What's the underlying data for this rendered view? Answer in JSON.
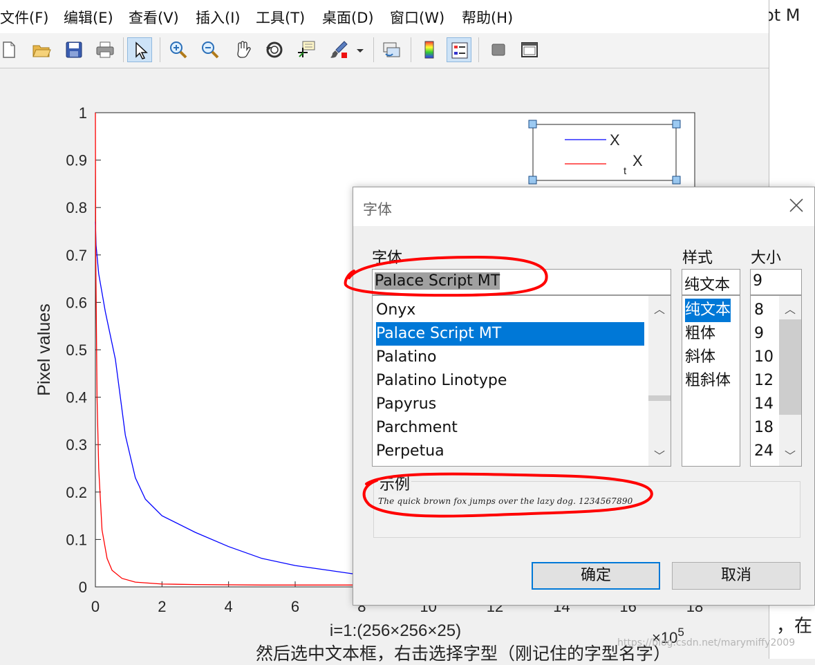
{
  "menubar": {
    "items": [
      "文件(F)",
      "编辑(E)",
      "查看(V)",
      "插入(I)",
      "工具(T)",
      "桌面(D)",
      "窗口(W)",
      "帮助(H)"
    ]
  },
  "toolbar": {
    "buttons": [
      "new-figure-icon",
      "open-file-icon",
      "save-icon",
      "print-icon",
      "pointer-icon",
      "zoom-in-icon",
      "zoom-out-icon",
      "pan-hand-icon",
      "rotate-3d-icon",
      "data-cursor-icon",
      "brush-icon",
      "link-plot-icon",
      "colorbar-icon",
      "legend-icon",
      "hide-tools-icon",
      "show-tools-icon"
    ],
    "pressed": [
      "pointer-icon",
      "legend-icon"
    ]
  },
  "background_document": {
    "title_fragment": "ript M",
    "text_line_1": "，在",
    "text_line_2": "然后选中文本框，右击选择字型（刚记住的字型名字）",
    "watermark": "https://blog.csdn.net/marymiffy2009"
  },
  "chart_data": {
    "type": "line",
    "xlabel": "i=1:(256×256×25)",
    "ylabel": "Pixel values",
    "x_exponent_label": "×10",
    "x_exponent_power": "5",
    "xlim": [
      0,
      18
    ],
    "ylim": [
      0,
      1
    ],
    "x_ticks": [
      "0",
      "2",
      "4",
      "6",
      "8",
      "10",
      "12",
      "14",
      "16",
      "18"
    ],
    "y_ticks": [
      "0",
      "0.1",
      "0.2",
      "0.3",
      "0.4",
      "0.5",
      "0.6",
      "0.7",
      "0.8",
      "0.9",
      "1"
    ],
    "series": [
      {
        "name": "X",
        "color": "#0000ff",
        "x": [
          0,
          0.02,
          0.1,
          0.3,
          0.6,
          0.9,
          1.2,
          1.5,
          2,
          3,
          4,
          5,
          6,
          7,
          8,
          9,
          10,
          12,
          14,
          16,
          17.5
        ],
        "y": [
          0.77,
          0.72,
          0.66,
          0.58,
          0.48,
          0.32,
          0.23,
          0.185,
          0.15,
          0.115,
          0.085,
          0.06,
          0.045,
          0.035,
          0.025,
          0.018,
          0.013,
          0.008,
          0.005,
          0.003,
          0.002
        ]
      },
      {
        "name": "X",
        "subscript_prefix": "t",
        "color": "#ff0000",
        "x": [
          0,
          0.01,
          0.05,
          0.1,
          0.2,
          0.35,
          0.5,
          0.8,
          1.2,
          2,
          3,
          5,
          8,
          12,
          17.5
        ],
        "y": [
          1.0,
          0.7,
          0.4,
          0.25,
          0.12,
          0.06,
          0.035,
          0.018,
          0.01,
          0.006,
          0.005,
          0.004,
          0.004,
          0.003,
          0.003
        ]
      }
    ],
    "legend_location": "top-right",
    "grid": false
  },
  "font_dialog": {
    "title": "字体",
    "font_label": "字体",
    "style_label": "样式",
    "size_label": "大小",
    "font_value": "Palace Script MT",
    "style_value": "纯文本",
    "size_value": "9",
    "font_list": [
      "Onyx",
      "Palace Script MT",
      "Palatino",
      "Palatino Linotype",
      "Papyrus",
      "Parchment",
      "Perpetua"
    ],
    "font_selected_index": 1,
    "style_list": [
      "纯文本",
      "粗体",
      "斜体",
      "粗斜体"
    ],
    "style_selected_index": 0,
    "size_list": [
      "8",
      "9",
      "10",
      "12",
      "14",
      "18",
      "24"
    ],
    "sample_label": "示例",
    "sample_text": "The quick brown fox jumps over the lazy dog. 1234567890",
    "ok_label": "确定",
    "cancel_label": "取消",
    "accent_color": "#0078d7",
    "annotation_color": "#ff0000"
  }
}
